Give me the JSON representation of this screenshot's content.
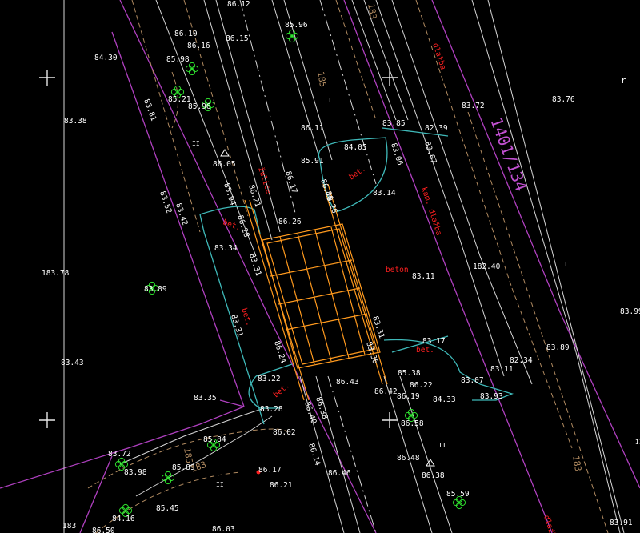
{
  "drawing": {
    "colors": {
      "background": "#000000",
      "spot_text": "#ffffff",
      "label_red": "#ff2020",
      "parcel_magenta": "#b040c0",
      "road_white": "#d8d8d8",
      "contour_tan": "#b08a60",
      "curb_cyan": "#3fb9b9",
      "bridge_orange": "#ff9a1e",
      "tree_green": "#2ee02e",
      "parcel_label": "#c050d0"
    },
    "spot_heights": [
      {
        "id": "h01",
        "text": "86.12"
      },
      {
        "id": "h02",
        "text": "86.10"
      },
      {
        "id": "h03",
        "text": "86.15"
      },
      {
        "id": "h04",
        "text": "85.96"
      },
      {
        "id": "h05",
        "text": "86.16"
      },
      {
        "id": "h06",
        "text": "84.30"
      },
      {
        "id": "h07",
        "text": "85.98"
      },
      {
        "id": "h08",
        "text": "85.21"
      },
      {
        "id": "h09",
        "text": "85.96"
      },
      {
        "id": "h10",
        "text": "83.38"
      },
      {
        "id": "h11",
        "text": "83.81"
      },
      {
        "id": "h12",
        "text": "86.11"
      },
      {
        "id": "h13",
        "text": "86.05"
      },
      {
        "id": "h14",
        "text": "83.85"
      },
      {
        "id": "h15",
        "text": "82.39"
      },
      {
        "id": "h16",
        "text": "84.05"
      },
      {
        "id": "h17",
        "text": "83.06"
      },
      {
        "id": "h18",
        "text": "83.07"
      },
      {
        "id": "h19",
        "text": "85.91"
      },
      {
        "id": "h20",
        "text": "86.17"
      },
      {
        "id": "h21",
        "text": "83.14"
      },
      {
        "id": "h22",
        "text": "83.72"
      },
      {
        "id": "h23",
        "text": "83.76"
      },
      {
        "id": "h24",
        "text": "86.26"
      },
      {
        "id": "h25",
        "text": "83.34"
      },
      {
        "id": "h26",
        "text": "83.31"
      },
      {
        "id": "h27",
        "text": "182.40"
      },
      {
        "id": "h28",
        "text": "83.11"
      },
      {
        "id": "h29",
        "text": "183.78"
      },
      {
        "id": "h30",
        "text": "83.89"
      },
      {
        "id": "h31",
        "text": "83.99"
      },
      {
        "id": "h32",
        "text": "83.31"
      },
      {
        "id": "h33",
        "text": "83.43"
      },
      {
        "id": "h34",
        "text": "83.17"
      },
      {
        "id": "h35",
        "text": "83.89"
      },
      {
        "id": "h36",
        "text": "82.34"
      },
      {
        "id": "h37",
        "text": "83.11"
      },
      {
        "id": "h38",
        "text": "83.07"
      },
      {
        "id": "h39",
        "text": "86.43"
      },
      {
        "id": "h40",
        "text": "85.38"
      },
      {
        "id": "h41",
        "text": "86.22"
      },
      {
        "id": "h42",
        "text": "86.42"
      },
      {
        "id": "h43",
        "text": "86.19"
      },
      {
        "id": "h44",
        "text": "84.33"
      },
      {
        "id": "h45",
        "text": "83.93"
      },
      {
        "id": "h46",
        "text": "83.22"
      },
      {
        "id": "h47",
        "text": "83.28"
      },
      {
        "id": "h48",
        "text": "83.35"
      },
      {
        "id": "h49",
        "text": "86.02"
      },
      {
        "id": "h50",
        "text": "86.38"
      },
      {
        "id": "h51",
        "text": "86.58"
      },
      {
        "id": "h52",
        "text": "85.84"
      },
      {
        "id": "h53",
        "text": "83.72"
      },
      {
        "id": "h54",
        "text": "83.98"
      },
      {
        "id": "h55",
        "text": "85.89"
      },
      {
        "id": "h56",
        "text": "86.17"
      },
      {
        "id": "h57",
        "text": "86.46"
      },
      {
        "id": "h58",
        "text": "86.48"
      },
      {
        "id": "h59",
        "text": "86.38"
      },
      {
        "id": "h60",
        "text": "86.21"
      },
      {
        "id": "h61",
        "text": "85.59"
      },
      {
        "id": "h62",
        "text": "84.16"
      },
      {
        "id": "h63",
        "text": "85.45"
      },
      {
        "id": "h64",
        "text": "86.03"
      },
      {
        "id": "h65",
        "text": "83.91"
      },
      {
        "id": "h66",
        "text": "86.50"
      },
      {
        "id": "h67",
        "text": "86.14"
      },
      {
        "id": "h68",
        "text": "83.52"
      },
      {
        "id": "h69",
        "text": "83.42"
      },
      {
        "id": "h70",
        "text": "85.94"
      },
      {
        "id": "h71",
        "text": "86.21"
      },
      {
        "id": "h72",
        "text": "86.28"
      },
      {
        "id": "h73",
        "text": "86.29"
      },
      {
        "id": "h74",
        "text": "86.26"
      },
      {
        "id": "h75",
        "text": "83.31"
      },
      {
        "id": "h76",
        "text": "83.36"
      },
      {
        "id": "h77",
        "text": "86.24"
      },
      {
        "id": "h78",
        "text": "86.40"
      },
      {
        "id": "h79",
        "text": "183"
      }
    ],
    "surface_labels": [
      {
        "id": "l1",
        "text": "dlažba"
      },
      {
        "id": "l2",
        "text": "žulice"
      },
      {
        "id": "l3",
        "text": "bet."
      },
      {
        "id": "l4",
        "text": "kam. dlažba"
      },
      {
        "id": "l5",
        "text": "bet."
      },
      {
        "id": "l6",
        "text": "beton"
      },
      {
        "id": "l7",
        "text": "bet."
      },
      {
        "id": "l8",
        "text": "bet."
      },
      {
        "id": "l9",
        "text": "bet."
      },
      {
        "id": "l10",
        "text": "dlažba"
      }
    ],
    "parcel_number": "1401/134",
    "contour_labels": [
      {
        "id": "c1",
        "text": "183"
      },
      {
        "id": "c2",
        "text": "185"
      },
      {
        "id": "c3",
        "text": "185"
      },
      {
        "id": "c4",
        "text": "183"
      },
      {
        "id": "c5",
        "text": "183"
      }
    ],
    "corner_mark": "r",
    "level_marks": [
      "II",
      "II",
      "II",
      "II",
      "II",
      "II"
    ]
  }
}
